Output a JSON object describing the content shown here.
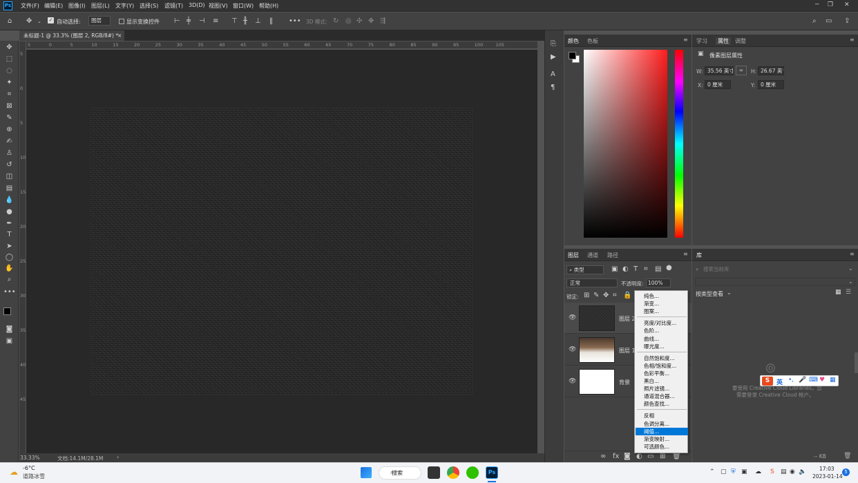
{
  "menubar": {
    "logo": "Ps",
    "items": [
      "文件(F)",
      "编辑(E)",
      "图像(I)",
      "图层(L)",
      "文字(Y)",
      "选择(S)",
      "滤镜(T)",
      "3D(D)",
      "视图(V)",
      "窗口(W)",
      "帮助(H)"
    ]
  },
  "options": {
    "auto_select_label": "自动选择:",
    "auto_select_value": "图层",
    "show_transform_label": "显示变换控件",
    "mode_3d_label": "3D 模式:"
  },
  "document": {
    "tab_title": "未标题-1 @ 33.3% (图层 2, RGB/8#) *",
    "zoom": "33.33%",
    "doc_size": "文档:14.1M/28.1M"
  },
  "ruler": {
    "h_ticks": [
      "5",
      "0",
      "5",
      "10",
      "15",
      "20",
      "25",
      "30",
      "35",
      "40",
      "45",
      "50",
      "55",
      "60",
      "65",
      "70",
      "75",
      "80",
      "85",
      "90",
      "95",
      "100",
      "105"
    ],
    "v_ticks": [
      "5",
      "0",
      "5",
      "10",
      "15",
      "20",
      "25",
      "30",
      "35",
      "40",
      "45"
    ]
  },
  "color_panel": {
    "tabs": [
      "颜色",
      "色板"
    ],
    "accent": "#ff1d1d"
  },
  "props_panel": {
    "tabs": [
      "学习",
      "属性",
      "调整"
    ],
    "section_title": "像素图层属性",
    "w_label": "W:",
    "w_value": "35.56 英寸",
    "h_label": "H:",
    "h_value": "26.67 英寸",
    "x_label": "X:",
    "x_value": "0 厘米",
    "y_label": "Y:",
    "y_value": "0 厘米"
  },
  "layers_panel": {
    "tabs": [
      "图层",
      "通道",
      "路径"
    ],
    "filter_kind": "类型",
    "blend_mode": "正常",
    "opacity_label": "不透明度:",
    "opacity_value": "100%",
    "lock_label": "锁定:",
    "layers": [
      {
        "name": "图层 2"
      },
      {
        "name": "图层 1"
      },
      {
        "name": "背景"
      }
    ]
  },
  "adjust_menu": {
    "groups": [
      [
        "纯色...",
        "渐变...",
        "图案..."
      ],
      [
        "亮度/对比度...",
        "色阶...",
        "曲线...",
        "曝光度..."
      ],
      [
        "自然饱和度...",
        "色相/饱和度...",
        "色彩平衡...",
        "黑白...",
        "照片滤镜...",
        "通道混合器...",
        "颜色查找..."
      ],
      [
        "反相",
        "色调分离...",
        "阈值...",
        "渐变映射...",
        "可选颜色..."
      ]
    ],
    "selected": "阈值..."
  },
  "library_panel": {
    "tab": "库",
    "search_placeholder": "搜索当前库",
    "view_by": "按类型查看",
    "message_line1": "要使用 Creative Cloud Libraries，您",
    "message_line2": "需要登录 Creative Cloud 帐户。",
    "size_label": "-- KB"
  },
  "ime": {
    "lang": "英"
  },
  "taskbar": {
    "weather_temp": "-6°C",
    "weather_desc": "道路冰雪",
    "search_label": "搜索",
    "time": "17:03",
    "date": "2023-01-14",
    "notify_count": "5"
  }
}
